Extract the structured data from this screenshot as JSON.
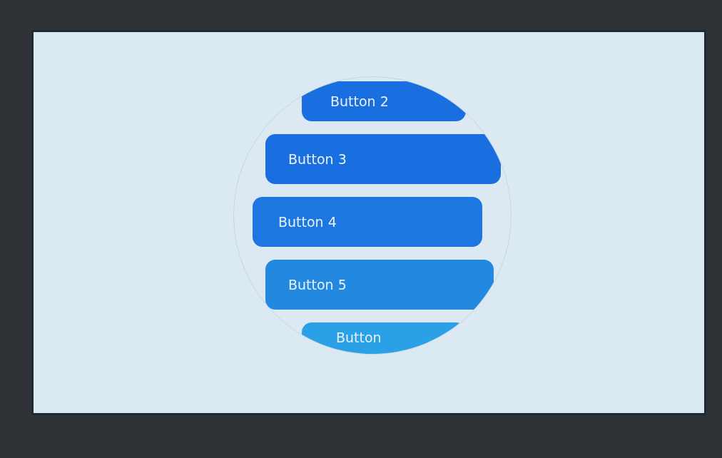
{
  "roller": {
    "buttons": [
      {
        "label": "Button 2"
      },
      {
        "label": "Button 3"
      },
      {
        "label": "Button 4"
      },
      {
        "label": "Button 5"
      },
      {
        "label": "Button"
      }
    ]
  }
}
